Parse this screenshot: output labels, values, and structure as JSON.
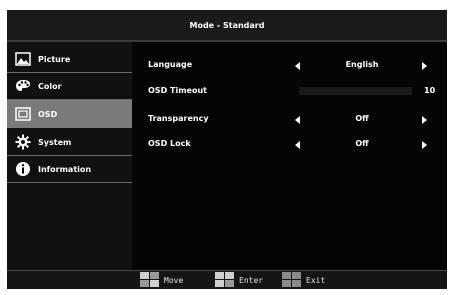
{
  "header": {
    "title": "Mode - Standard"
  },
  "sidebar": {
    "items": [
      {
        "label": "Picture",
        "icon": "picture-icon"
      },
      {
        "label": "Color",
        "icon": "palette-icon"
      },
      {
        "label": "OSD",
        "icon": "osd-screen-icon",
        "selected": true
      },
      {
        "label": "System",
        "icon": "gear-icon"
      },
      {
        "label": "Information",
        "icon": "info-icon"
      }
    ]
  },
  "settings": {
    "language": {
      "label": "Language",
      "value": "English"
    },
    "osd_timeout": {
      "label": "OSD Timeout",
      "value": "10"
    },
    "transparency": {
      "label": "Transparency",
      "value": "Off"
    },
    "osd_lock": {
      "label": "OSD Lock",
      "value": "Off"
    }
  },
  "footer": {
    "move_label": "Move",
    "enter_label": "Enter",
    "exit_label": "Exit"
  },
  "colors": {
    "background": "#000000",
    "selected_item": "#7a7a7a",
    "text": "#ffffff"
  }
}
